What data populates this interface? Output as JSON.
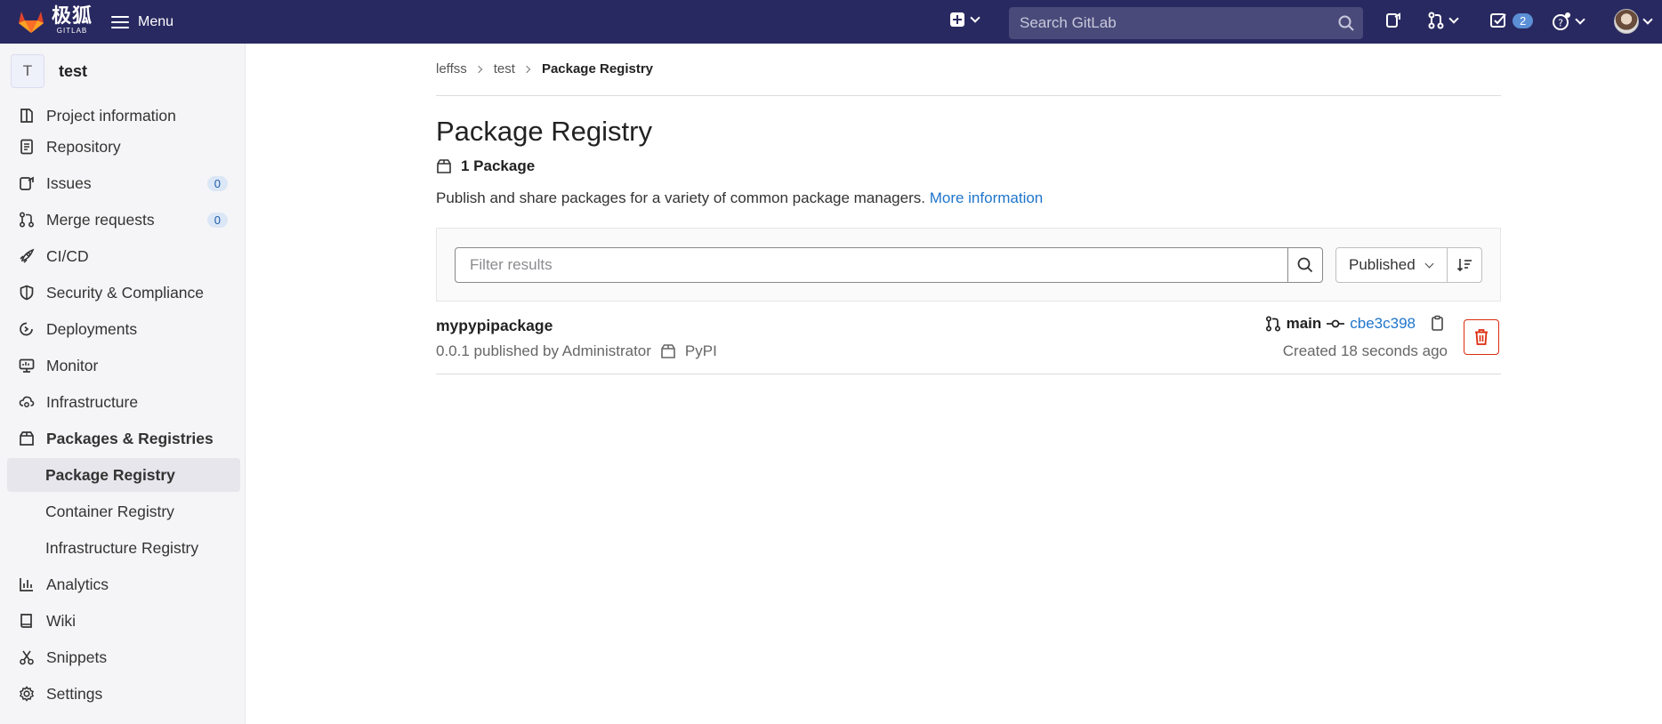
{
  "topbar": {
    "logo_cn": "极狐",
    "logo_en": "GITLAB",
    "menu_label": "Menu",
    "search_placeholder": "Search GitLab",
    "todo_count": "2"
  },
  "sidebar": {
    "project_initial": "T",
    "project_name": "test",
    "items": [
      {
        "label": "Project information",
        "icon": "info-icon"
      },
      {
        "label": "Repository",
        "icon": "doc-icon"
      },
      {
        "label": "Issues",
        "icon": "issues-icon",
        "count": "0"
      },
      {
        "label": "Merge requests",
        "icon": "merge-icon",
        "count": "0"
      },
      {
        "label": "CI/CD",
        "icon": "rocket-icon"
      },
      {
        "label": "Security & Compliance",
        "icon": "shield-icon"
      },
      {
        "label": "Deployments",
        "icon": "deploy-icon"
      },
      {
        "label": "Monitor",
        "icon": "monitor-icon"
      },
      {
        "label": "Infrastructure",
        "icon": "cloud-icon"
      },
      {
        "label": "Packages & Registries",
        "icon": "package-icon"
      },
      {
        "label": "Package Registry"
      },
      {
        "label": "Container Registry"
      },
      {
        "label": "Infrastructure Registry"
      },
      {
        "label": "Analytics",
        "icon": "chart-icon"
      },
      {
        "label": "Wiki",
        "icon": "book-icon"
      },
      {
        "label": "Snippets",
        "icon": "scissors-icon"
      },
      {
        "label": "Settings",
        "icon": "gear-icon"
      }
    ]
  },
  "breadcrumb": [
    "leffss",
    "test",
    "Package Registry"
  ],
  "page": {
    "title": "Package Registry",
    "count_label": "1 Package",
    "description": "Publish and share packages for a variety of common package managers.",
    "more_info": "More information"
  },
  "filter": {
    "placeholder": "Filter results",
    "sort_label": "Published"
  },
  "package": {
    "name": "mypypipackage",
    "meta": "0.0.1 published by Administrator",
    "type": "PyPI",
    "branch": "main",
    "commit": "cbe3c398",
    "created": "Created 18 seconds ago"
  }
}
